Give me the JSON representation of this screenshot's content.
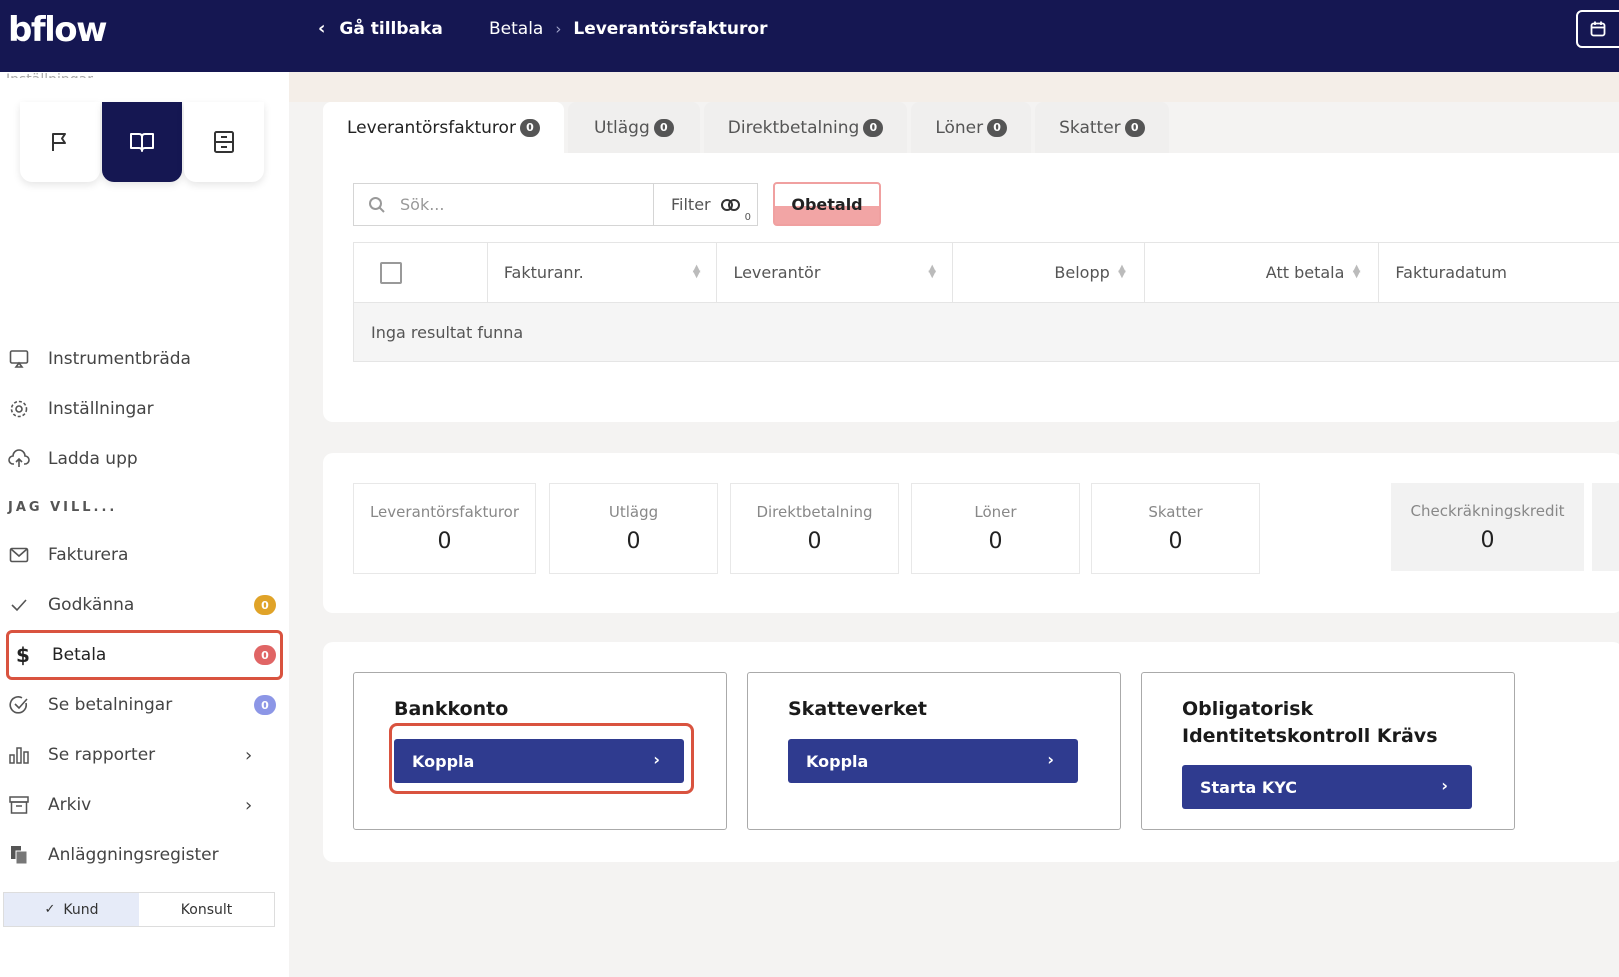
{
  "app": {
    "logo": "bflow"
  },
  "topbar": {
    "back_label": "Gå tillbaka",
    "breadcrumb": [
      "Betala",
      "Leverantörsfakturor"
    ]
  },
  "sidebar": {
    "cut_text": "Inställningar",
    "icon_tabs": [
      "flag-icon",
      "book-icon",
      "archive-box-icon"
    ],
    "items_top": [
      {
        "label": "Instrumentbräda",
        "icon": "monitor-icon"
      },
      {
        "label": "Inställningar",
        "icon": "gear-icon"
      },
      {
        "label": "Ladda upp",
        "icon": "upload-cloud-icon"
      }
    ],
    "section_label": "JAG VILL...",
    "items_bottom": [
      {
        "label": "Fakturera",
        "icon": "mail-icon"
      },
      {
        "label": "Godkänna",
        "icon": "check-icon",
        "badge": "0"
      },
      {
        "label": "Betala",
        "icon": "dollar-icon",
        "badge": "0"
      },
      {
        "label": "Se betalningar",
        "icon": "check-circle-icon",
        "badge": "0"
      },
      {
        "label": "Se rapporter",
        "icon": "bar-chart-icon"
      },
      {
        "label": "Arkiv",
        "icon": "archive-icon"
      },
      {
        "label": "Anläggningsregister",
        "icon": "files-icon"
      }
    ],
    "toggle": {
      "left": "Kund",
      "right": "Konsult"
    }
  },
  "tabs": [
    {
      "label": "Leverantörsfakturor",
      "count": "0"
    },
    {
      "label": "Utlägg",
      "count": "0"
    },
    {
      "label": "Direktbetalning",
      "count": "0"
    },
    {
      "label": "Löner",
      "count": "0"
    },
    {
      "label": "Skatter",
      "count": "0"
    }
  ],
  "filters": {
    "search_placeholder": "Sök...",
    "filter_label": "Filter",
    "filter_count": "0",
    "status_chip": "Obetald"
  },
  "table": {
    "columns": [
      "Fakturanr.",
      "Leverantör",
      "Belopp",
      "Att betala",
      "Fakturadatum"
    ],
    "empty_text": "Inga resultat funna"
  },
  "stats": [
    {
      "label": "Leverantörsfakturor",
      "value": "0"
    },
    {
      "label": "Utlägg",
      "value": "0"
    },
    {
      "label": "Direktbetalning",
      "value": "0"
    },
    {
      "label": "Löner",
      "value": "0"
    },
    {
      "label": "Skatter",
      "value": "0"
    },
    {
      "label": "Checkräkningskredit",
      "value": "0"
    }
  ],
  "connections": [
    {
      "title": "Bankkonto",
      "button": "Koppla"
    },
    {
      "title": "Skatteverket",
      "button": "Koppla"
    },
    {
      "title": "Obligatorisk Identitetskontroll Krävs",
      "button": "Starta KYC"
    }
  ],
  "colors": {
    "navy": "#151752",
    "button": "#2f3b8f",
    "highlight": "#d9533f",
    "badge_yellow": "#e0a328",
    "badge_red": "#e06565",
    "badge_blue": "#8c96e6"
  }
}
